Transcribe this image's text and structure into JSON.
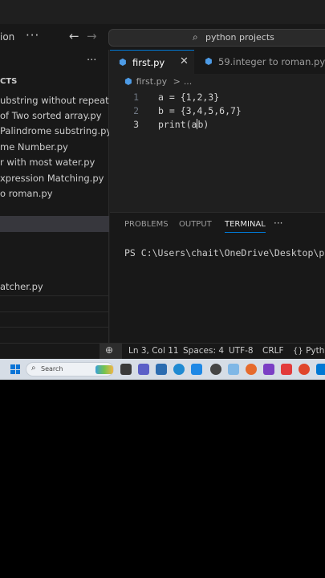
{
  "titlebar": {
    "title_partial": "ion",
    "more_label": "···",
    "back_arrow": "←",
    "forward_arrow": "→",
    "search_icon": "🔍",
    "search_text": "python projects"
  },
  "sidebar": {
    "more_label": "···",
    "section_title": "CTS",
    "files": [
      "ubstring without repeati...",
      "of Two sorted array.py",
      "Palindrome substring.py",
      "me Number.py",
      "r with most water.py",
      "xpression Matching.py",
      "o roman.py",
      "",
      "",
      "",
      "atcher.py"
    ]
  },
  "tabs": [
    {
      "label": "first.py",
      "active": true,
      "close": "✕"
    },
    {
      "label": "59.integer to roman.py",
      "active": false
    }
  ],
  "breadcrumb": {
    "file": "first.py",
    "separator": ">",
    "rest": "..."
  },
  "editor": {
    "lines": [
      {
        "num": "1",
        "text": "a = {1,2,3}"
      },
      {
        "num": "2",
        "text": "b = {3,4,5,6,7}"
      },
      {
        "num": "3",
        "before_cursor": "print(a",
        "after_cursor": "b)"
      }
    ]
  },
  "panel": {
    "tabs": [
      "PROBLEMS",
      "OUTPUT",
      "TERMINAL"
    ],
    "active_tab": "TERMINAL",
    "more_label": "···",
    "terminal_line": "PS C:\\Users\\chait\\OneDrive\\Desktop\\pyth"
  },
  "statusbar": {
    "position": "Ln 3, Col 11",
    "spaces": "Spaces: 4",
    "encoding": "UTF-8",
    "eol": "CRLF",
    "language": "Pytho"
  },
  "taskbar": {
    "search_placeholder": "Search",
    "colors": {
      "accent": "#0078d4",
      "taskbar_bg": "#d6dde6"
    }
  }
}
